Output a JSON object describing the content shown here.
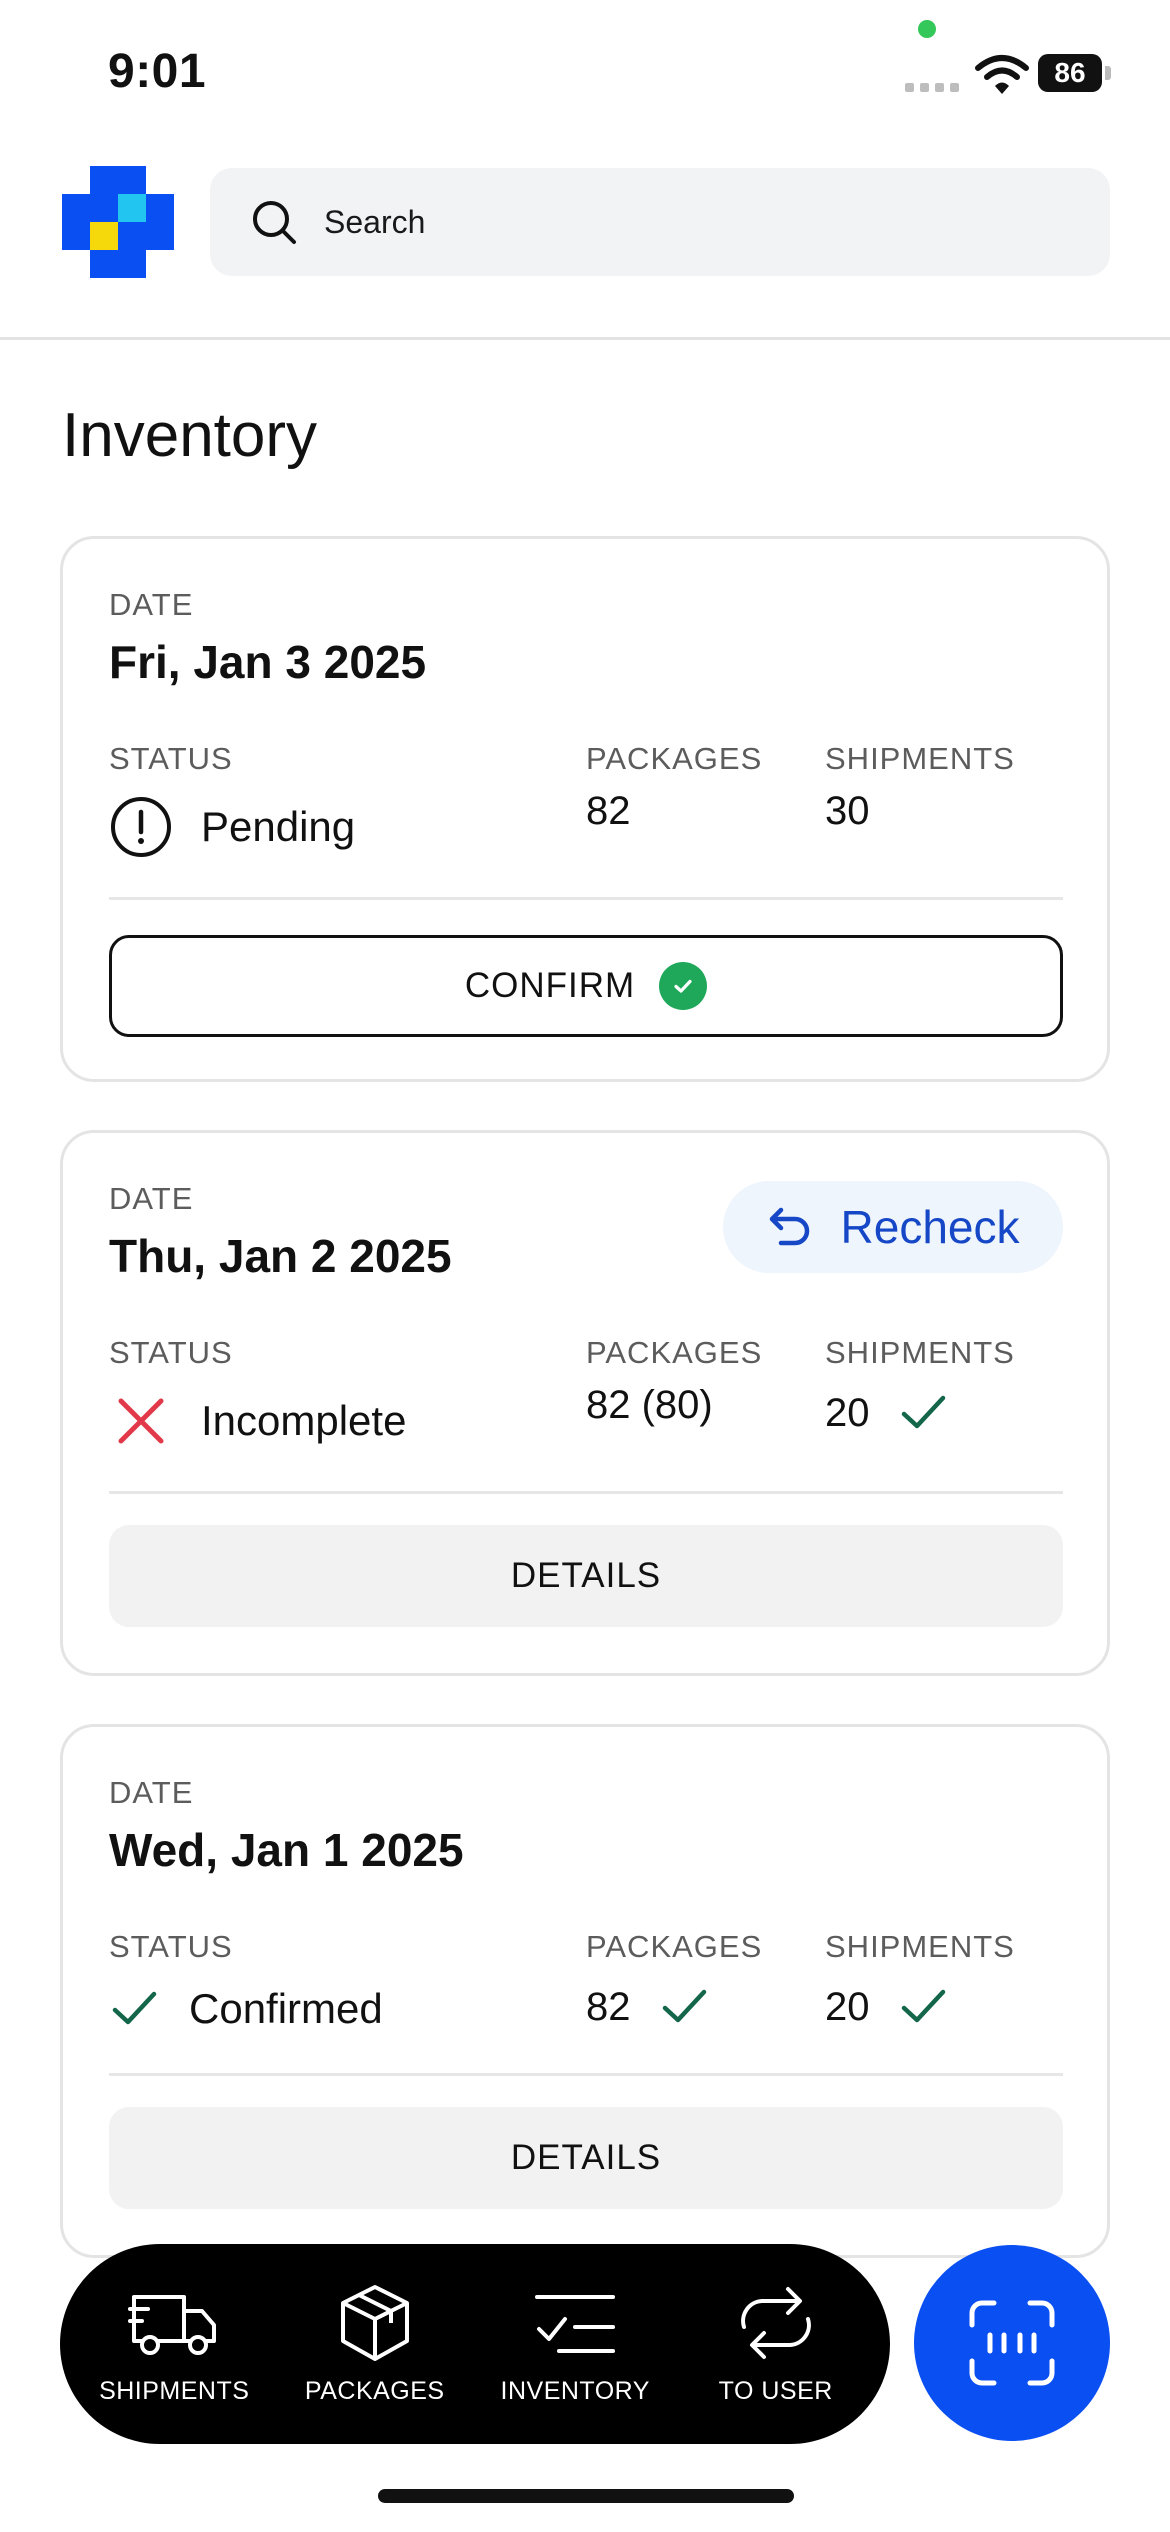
{
  "status_bar": {
    "time": "9:01",
    "battery": "86"
  },
  "search": {
    "placeholder": "Search"
  },
  "page": {
    "title": "Inventory"
  },
  "labels": {
    "date": "DATE",
    "status": "STATUS",
    "packages": "PACKAGES",
    "shipments": "SHIPMENTS"
  },
  "cards": [
    {
      "date": "Fri, Jan 3 2025",
      "status": "Pending",
      "status_icon": "exclamation-circle-icon",
      "packages": "82",
      "shipments": "30",
      "action": "CONFIRM"
    },
    {
      "date": "Thu, Jan 2 2025",
      "status": "Incomplete",
      "status_icon": "x-mark-icon",
      "packages": "82 (80)",
      "shipments": "20",
      "recheck": "Recheck",
      "action": "DETAILS"
    },
    {
      "date": "Wed, Jan 1 2025",
      "status": "Confirmed",
      "status_icon": "checkmark-icon",
      "packages": "82",
      "shipments": "20",
      "action": "DETAILS"
    }
  ],
  "nav": {
    "shipments": "SHIPMENTS",
    "packages": "PACKAGES",
    "inventory": "INVENTORY",
    "to_user": "TO USER"
  },
  "colors": {
    "accent_blue": "#0a4ff2",
    "success_green": "#1fa85a",
    "check_green": "#13664a",
    "error_red": "#e2394a",
    "recheck_blue": "#1547c7"
  }
}
